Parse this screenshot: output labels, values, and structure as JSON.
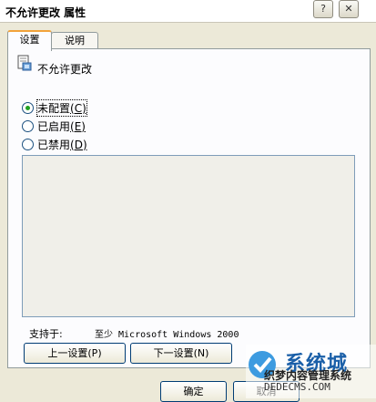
{
  "window": {
    "title": "不允许更改 属性",
    "help_glyph": "?",
    "close_glyph": "✕"
  },
  "tabs": [
    {
      "label": "设置"
    },
    {
      "label": "说明"
    }
  ],
  "policy": {
    "name": "不允许更改"
  },
  "options": [
    {
      "text": "未配置",
      "accel": "(C)",
      "checked": true
    },
    {
      "text": "已启用",
      "accel": "(E)",
      "checked": false
    },
    {
      "text": "已禁用",
      "accel": "(D)",
      "checked": false
    }
  ],
  "supported": {
    "label": "支持于:",
    "value": "至少 Microsoft Windows 2000"
  },
  "buttons": {
    "prev": "上一设置(P)",
    "next": "下一设置(N)",
    "ok": "确定",
    "cancel": "取消"
  },
  "watermark": {
    "brand": "系统城",
    "subtitle": "织梦内容管理系统",
    "url": "DEDECMS.COM"
  },
  "colors": {
    "radio_dot": "#21a121",
    "active_tab_accent": "#f2a33a",
    "brand": "#1a5fa8"
  }
}
